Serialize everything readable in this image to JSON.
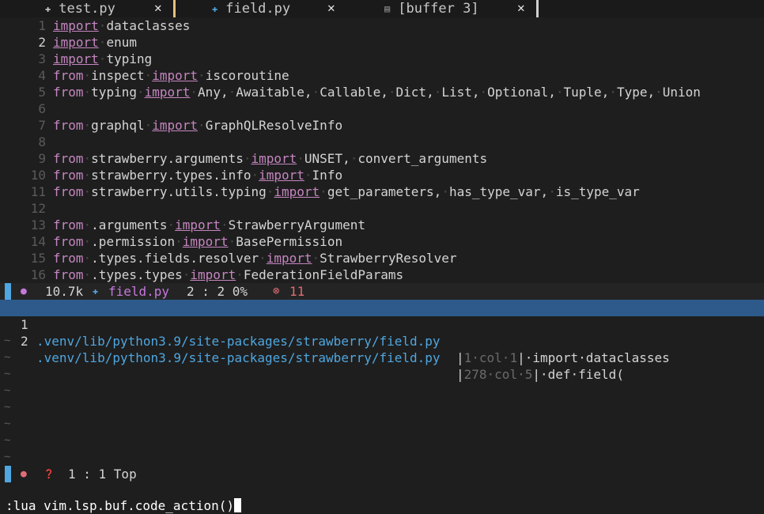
{
  "colors": {
    "background": "#1e1e1e",
    "keyword": "#c586c0",
    "path": "#4fa6e0",
    "selection": "#2d5a8a",
    "error": "#e06c75",
    "active_tab_bar": "#e5c07b",
    "mode_bar": "#4fa6e0"
  },
  "tabs": [
    {
      "icon": "python-file-icon",
      "name": "test.py",
      "close": "✕"
    },
    {
      "icon": "python-file-icon",
      "name": "field.py",
      "close": "✕"
    },
    {
      "icon": "text-file-icon",
      "name": "[buffer 3]",
      "close": "✕"
    }
  ],
  "editor": {
    "lines": [
      {
        "num": "1",
        "current": false,
        "tokens": [
          [
            "kwimport",
            "import"
          ],
          [
            "dot",
            "·"
          ],
          [
            "txt",
            "dataclasses"
          ]
        ]
      },
      {
        "num": "2",
        "current": true,
        "tokens": [
          [
            "kwimport",
            "import"
          ],
          [
            "dot",
            "·"
          ],
          [
            "txt",
            "enum"
          ]
        ]
      },
      {
        "num": "3",
        "current": false,
        "tokens": [
          [
            "kwimport",
            "import"
          ],
          [
            "dot",
            "·"
          ],
          [
            "txt",
            "typing"
          ]
        ]
      },
      {
        "num": "4",
        "current": false,
        "tokens": [
          [
            "kw",
            "from"
          ],
          [
            "dot",
            "·"
          ],
          [
            "txt",
            "inspect"
          ],
          [
            "dot",
            "·"
          ],
          [
            "kwimport",
            "import"
          ],
          [
            "dot",
            "·"
          ],
          [
            "txt",
            "iscoroutine"
          ]
        ]
      },
      {
        "num": "5",
        "current": false,
        "tokens": [
          [
            "kw",
            "from"
          ],
          [
            "dot",
            "·"
          ],
          [
            "txt",
            "typing"
          ],
          [
            "dot",
            "·"
          ],
          [
            "kwimport",
            "import"
          ],
          [
            "dot",
            "·"
          ],
          [
            "txt",
            "Any,"
          ],
          [
            "dot",
            "·"
          ],
          [
            "txt",
            "Awaitable,"
          ],
          [
            "dot",
            "·"
          ],
          [
            "txt",
            "Callable,"
          ],
          [
            "dot",
            "·"
          ],
          [
            "txt",
            "Dict,"
          ],
          [
            "dot",
            "·"
          ],
          [
            "txt",
            "List,"
          ],
          [
            "dot",
            "·"
          ],
          [
            "txt",
            "Optional,"
          ],
          [
            "dot",
            "·"
          ],
          [
            "txt",
            "Tuple,"
          ],
          [
            "dot",
            "·"
          ],
          [
            "txt",
            "Type,"
          ],
          [
            "dot",
            "·"
          ],
          [
            "txt",
            "Union"
          ]
        ]
      },
      {
        "num": "6",
        "current": false,
        "tokens": []
      },
      {
        "num": "7",
        "current": false,
        "tokens": [
          [
            "kw",
            "from"
          ],
          [
            "dot",
            "·"
          ],
          [
            "txt",
            "graphql"
          ],
          [
            "dot",
            "·"
          ],
          [
            "kwimport",
            "import"
          ],
          [
            "dot",
            "·"
          ],
          [
            "txt",
            "GraphQLResolveInfo"
          ]
        ]
      },
      {
        "num": "8",
        "current": false,
        "tokens": []
      },
      {
        "num": "9",
        "current": false,
        "tokens": [
          [
            "kw",
            "from"
          ],
          [
            "dot",
            "·"
          ],
          [
            "txt",
            "strawberry.arguments"
          ],
          [
            "dot",
            "·"
          ],
          [
            "kwimport",
            "import"
          ],
          [
            "dot",
            "·"
          ],
          [
            "txt",
            "UNSET,"
          ],
          [
            "dot",
            "·"
          ],
          [
            "txt",
            "convert_arguments"
          ]
        ]
      },
      {
        "num": "10",
        "current": false,
        "tokens": [
          [
            "kw",
            "from"
          ],
          [
            "dot",
            "·"
          ],
          [
            "txt",
            "strawberry.types.info"
          ],
          [
            "dot",
            "·"
          ],
          [
            "kwimport",
            "import"
          ],
          [
            "dot",
            "·"
          ],
          [
            "txt",
            "Info"
          ]
        ]
      },
      {
        "num": "11",
        "current": false,
        "tokens": [
          [
            "kw",
            "from"
          ],
          [
            "dot",
            "·"
          ],
          [
            "txt",
            "strawberry.utils.typing"
          ],
          [
            "dot",
            "·"
          ],
          [
            "kwimport",
            "import"
          ],
          [
            "dot",
            "·"
          ],
          [
            "txt",
            "get_parameters,"
          ],
          [
            "dot",
            "·"
          ],
          [
            "txt",
            "has_type_var,"
          ],
          [
            "dot",
            "·"
          ],
          [
            "txt",
            "is_type_var"
          ]
        ]
      },
      {
        "num": "12",
        "current": false,
        "tokens": []
      },
      {
        "num": "13",
        "current": false,
        "tokens": [
          [
            "kw",
            "from"
          ],
          [
            "dot",
            "·"
          ],
          [
            "txt",
            ".arguments"
          ],
          [
            "dot",
            "·"
          ],
          [
            "kwimport",
            "import"
          ],
          [
            "dot",
            "·"
          ],
          [
            "txt",
            "StrawberryArgument"
          ]
        ]
      },
      {
        "num": "14",
        "current": false,
        "tokens": [
          [
            "kw",
            "from"
          ],
          [
            "dot",
            "·"
          ],
          [
            "txt",
            ".permission"
          ],
          [
            "dot",
            "·"
          ],
          [
            "kwimport",
            "import"
          ],
          [
            "dot",
            "·"
          ],
          [
            "txt",
            "BasePermission"
          ]
        ]
      },
      {
        "num": "15",
        "current": false,
        "tokens": [
          [
            "kw",
            "from"
          ],
          [
            "dot",
            "·"
          ],
          [
            "txt",
            ".types.fields.resolver"
          ],
          [
            "dot",
            "·"
          ],
          [
            "kwimport",
            "import"
          ],
          [
            "dot",
            "·"
          ],
          [
            "txt",
            "StrawberryResolver"
          ]
        ]
      },
      {
        "num": "16",
        "current": false,
        "tokens": [
          [
            "kw",
            "from"
          ],
          [
            "dot",
            "·"
          ],
          [
            "txt",
            ".types.types"
          ],
          [
            "dot",
            "·"
          ],
          [
            "kwimport",
            "import"
          ],
          [
            "dot",
            "·"
          ],
          [
            "txt",
            "FederationFieldParams"
          ]
        ]
      }
    ]
  },
  "statusline1": {
    "dot": "●",
    "size": "10.7k",
    "file_icon": "python-file-icon",
    "filename": "field.py",
    "position": "2 : 2 0%",
    "error_icon": "⊗",
    "error_count": "11"
  },
  "quickfix": {
    "items": [
      {
        "num": "1",
        "path": ".venv/lib/python3.9/site-packages/strawberry/field.py",
        "bar1": "|",
        "meta": "1·col·1",
        "bar2": "|",
        "code": "·import·dataclasses",
        "selected": true
      },
      {
        "num": "2",
        "path": ".venv/lib/python3.9/site-packages/strawberry/field.py",
        "bar1": "|",
        "meta": "278·col·5",
        "bar2": "|",
        "code": "·def·field(",
        "selected": false
      }
    ],
    "tildes": [
      "~",
      "~",
      "~",
      "~",
      "~",
      "~",
      "~",
      "~"
    ]
  },
  "statusline2": {
    "dot": "●",
    "help_icon": "?",
    "position": "1 : 1 Top"
  },
  "cmdline": {
    "text": ":lua vim.lsp.buf.code_action()"
  }
}
